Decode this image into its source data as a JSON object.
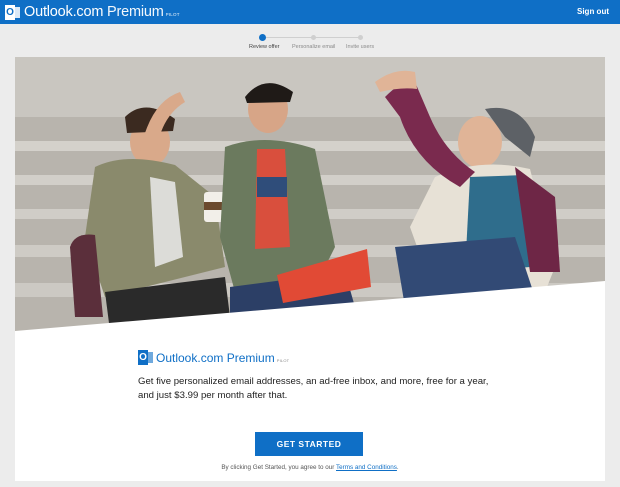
{
  "header": {
    "brand_name": "Outlook.com",
    "brand_premium": "Premium",
    "brand_tag": "PILOT",
    "signout_label": "Sign out",
    "logo_icon": "outlook-icon",
    "bg_color": "#0f6fc6"
  },
  "steps": [
    {
      "label": "Review offer",
      "active": true
    },
    {
      "label": "Personalize email",
      "active": false
    },
    {
      "label": "Invite users",
      "active": false
    }
  ],
  "hero": {
    "image_desc": "three young men sitting on steps high-fiving, one holding a red laptop"
  },
  "card": {
    "brand_name": "Outlook.com",
    "brand_premium": "Premium",
    "brand_tag": "PILOT",
    "description": "Get five personalized email addresses, an ad-free inbox, and more, free for a year, and just $3.99 per month after that.",
    "cta_label": "GET STARTED",
    "legal_prefix": "By clicking Get Started, you agree to our ",
    "legal_link": "Terms and Conditions",
    "legal_suffix": "."
  }
}
